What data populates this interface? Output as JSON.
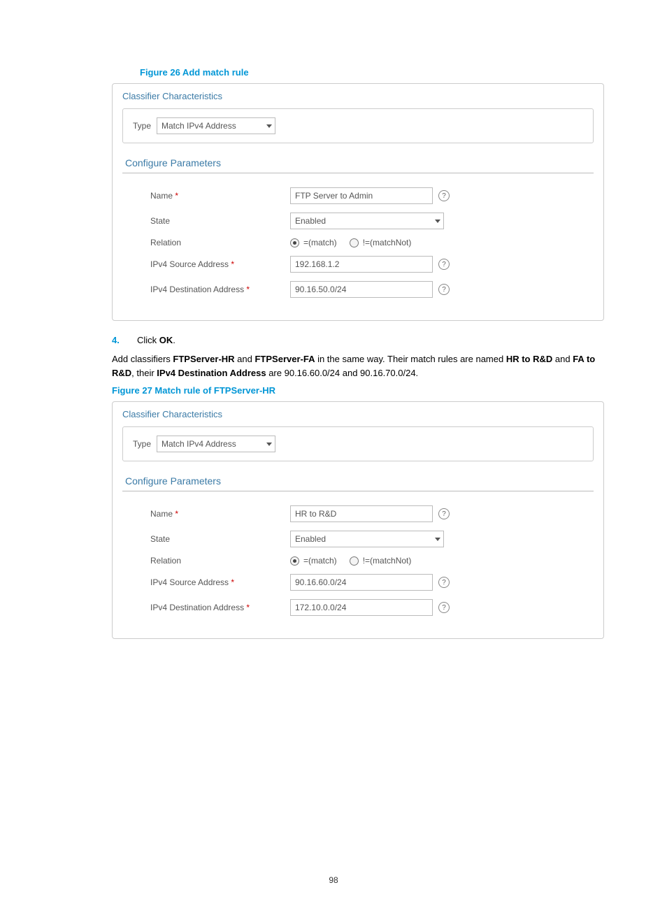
{
  "figure26": {
    "title": "Figure 26 Add match rule",
    "panel_title": "Classifier Characteristics",
    "type_label": "Type",
    "type_value": "Match IPv4 Address",
    "section_title": "Configure Parameters",
    "rows": {
      "name_label": "Name",
      "name_value": "FTP Server to Admin",
      "state_label": "State",
      "state_value": "Enabled",
      "relation_label": "Relation",
      "relation_match": "=(match)",
      "relation_matchnot": "!=(matchNot)",
      "src_label": "IPv4 Source Address",
      "src_value": "192.168.1.2",
      "dst_label": "IPv4 Destination Address",
      "dst_value": "90.16.50.0/24"
    }
  },
  "step4": {
    "num": "4.",
    "text_prefix": "Click ",
    "ok": "OK",
    "text_suffix": "."
  },
  "paragraph": {
    "p1a": "Add classifiers ",
    "b1": "FTPServer-HR",
    "p1b": " and ",
    "b2": "FTPServer-FA",
    "p1c": " in the same way. Their match rules are named ",
    "b3": "HR to R&D",
    "p1d": " and ",
    "b4": "FA to R&D",
    "p1e": ", their ",
    "b5": "IPv4 Destination Address",
    "p1f": " are 90.16.60.0/24 and 90.16.70.0/24."
  },
  "figure27": {
    "title": "Figure 27 Match rule of FTPServer-HR",
    "panel_title": "Classifier Characteristics",
    "type_label": "Type",
    "type_value": "Match IPv4 Address",
    "section_title": "Configure Parameters",
    "rows": {
      "name_label": "Name",
      "name_value": "HR to R&D",
      "state_label": "State",
      "state_value": "Enabled",
      "relation_label": "Relation",
      "relation_match": "=(match)",
      "relation_matchnot": "!=(matchNot)",
      "src_label": "IPv4 Source Address",
      "src_value": "90.16.60.0/24",
      "dst_label": "IPv4 Destination Address",
      "dst_value": "172.10.0.0/24"
    }
  },
  "page_number": "98"
}
